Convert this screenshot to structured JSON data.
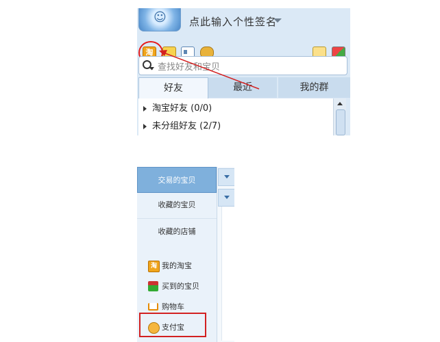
{
  "chat_client": {
    "signature_placeholder": "点此输入个性签名",
    "search_placeholder": "查找好友和宝贝",
    "tabs": [
      {
        "label": "好友",
        "active": true
      },
      {
        "label": "最近",
        "active": false
      },
      {
        "label": "我的群",
        "active": false
      }
    ],
    "groups": [
      {
        "label": "淘宝好友 (0/0)"
      },
      {
        "label": "未分组好友 (2/7)"
      }
    ],
    "toolbar_icons": [
      "taobao-icon",
      "chat-icon",
      "card-icon",
      "bag-icon",
      "mail-icon",
      "apps-icon"
    ],
    "taobao_icon_glyph": "淘"
  },
  "side_menu": {
    "items": [
      {
        "label": "交易的宝贝",
        "active": true
      },
      {
        "label": "收藏的宝贝",
        "active": false
      },
      {
        "label": "收藏的店铺",
        "active": false
      }
    ],
    "links": [
      {
        "label": "我的淘宝",
        "icon": "taobao-icon",
        "icon_glyph": "淘"
      },
      {
        "label": "买到的宝贝",
        "icon": "gift-icon"
      },
      {
        "label": "购物车",
        "icon": "cart-icon"
      },
      {
        "label": "支付宝",
        "icon": "alipay-icon"
      }
    ]
  },
  "colors": {
    "panel_bg": "#dbe9f6",
    "highlight_red": "#e51b1b",
    "active_menu": "#7fb0dc"
  }
}
